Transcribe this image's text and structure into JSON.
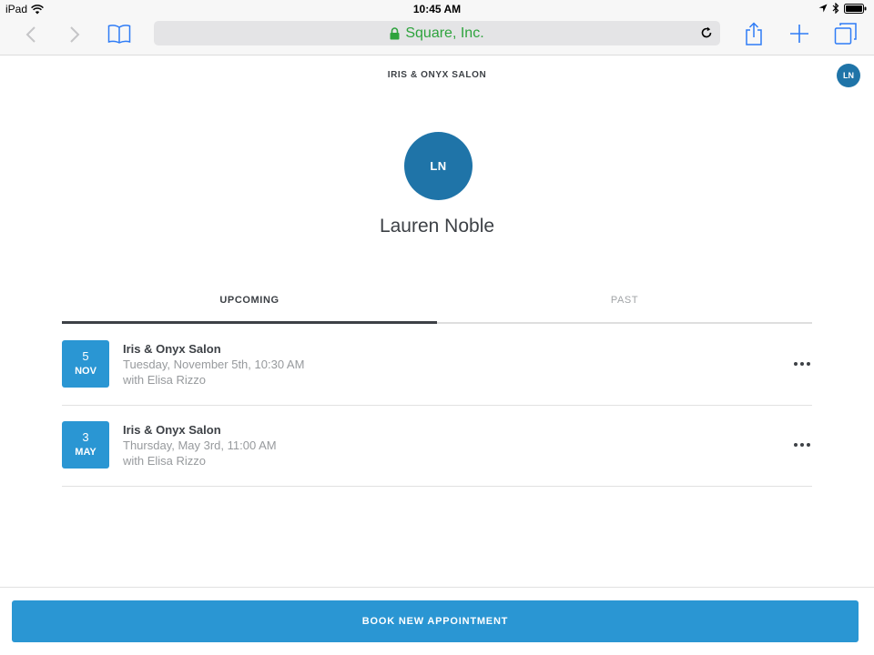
{
  "status_bar": {
    "device": "iPad",
    "time": "10:45 AM"
  },
  "browser": {
    "url_display": "Square, Inc.",
    "secure_color": "#2ea33d",
    "icons": [
      "back-icon",
      "forward-icon",
      "bookmarks-icon",
      "lock-icon",
      "reload-icon",
      "share-icon",
      "new-tab-icon",
      "tabs-icon"
    ]
  },
  "header": {
    "merchant": "IRIS & ONYX SALON",
    "user_initials": "LN"
  },
  "profile": {
    "initials": "LN",
    "name": "Lauren Noble"
  },
  "tabs": [
    {
      "label": "UPCOMING",
      "active": true
    },
    {
      "label": "PAST",
      "active": false
    }
  ],
  "appointments": [
    {
      "day": "5",
      "month": "NOV",
      "title": "Iris & Onyx Salon",
      "when": "Tuesday, November 5th, 10:30 AM",
      "with": "with Elisa Rizzo"
    },
    {
      "day": "3",
      "month": "MAY",
      "title": "Iris & Onyx Salon",
      "when": "Thursday, May 3rd, 11:00 AM",
      "with": "with Elisa Rizzo"
    }
  ],
  "footer": {
    "book_label": "BOOK NEW APPOINTMENT"
  },
  "colors": {
    "accent": "#2a96d3",
    "avatar": "#1f74a8",
    "text": "#3d4146",
    "muted": "#979a9d"
  }
}
